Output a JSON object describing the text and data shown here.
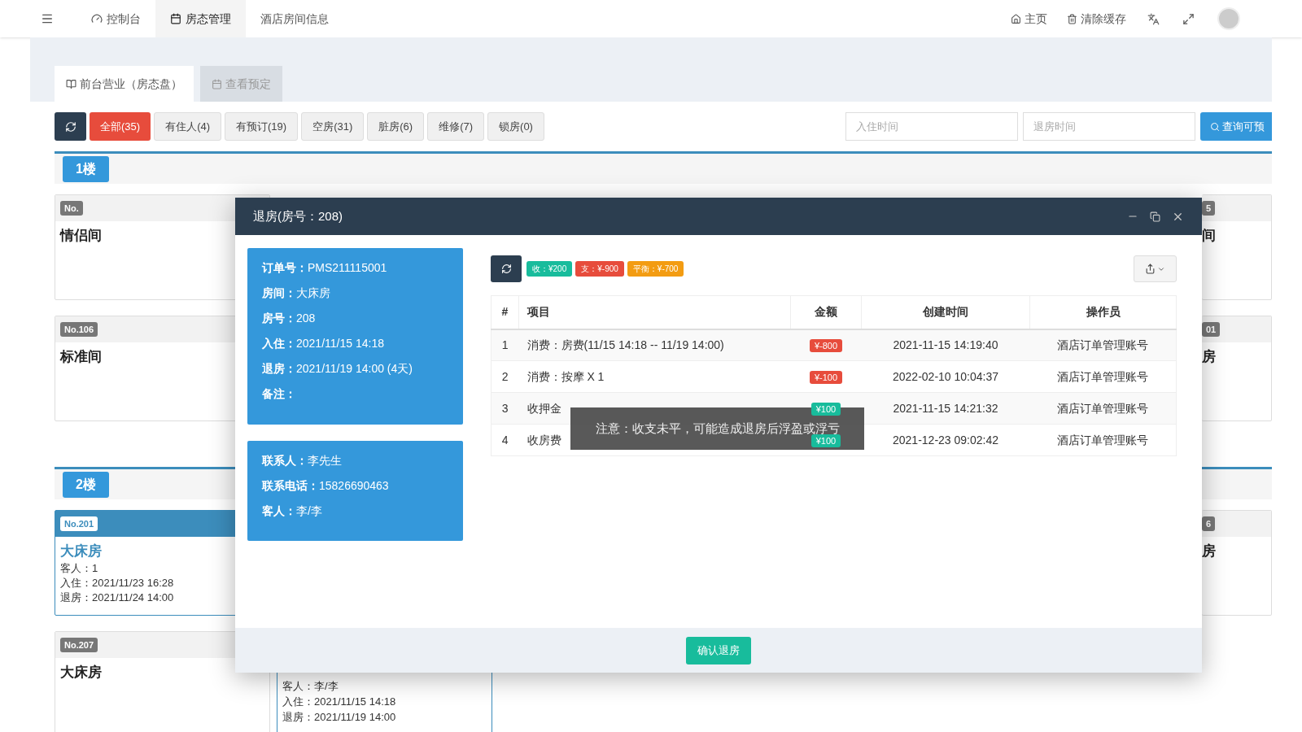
{
  "nav": {
    "items": [
      {
        "label": "控制台",
        "selected": false
      },
      {
        "label": "房态管理",
        "selected": true
      },
      {
        "label": "酒店房间信息",
        "selected": false
      }
    ],
    "right": [
      {
        "label": "主页"
      },
      {
        "label": "清除缓存"
      }
    ]
  },
  "page_tabs": [
    {
      "label": "前台营业（房态盘）",
      "selected": true
    },
    {
      "label": "查看预定",
      "selected": false
    }
  ],
  "filters": [
    {
      "label": "全部(35)",
      "selected": true
    },
    {
      "label": "有住人(4)",
      "selected": false
    },
    {
      "label": "有预订(19)",
      "selected": false
    },
    {
      "label": "空房(31)",
      "selected": false
    },
    {
      "label": "脏房(6)",
      "selected": false
    },
    {
      "label": "维修(7)",
      "selected": false
    },
    {
      "label": "锁房(0)",
      "selected": false
    }
  ],
  "date_fields": [
    {
      "placeholder": "入住时间"
    },
    {
      "placeholder": "退房时间"
    }
  ],
  "search_button": "查询可预",
  "floors": [
    {
      "label": "1楼",
      "rows": [
        {
          "left": {
            "number": "No.",
            "title": "情侣间",
            "occupied": false
          },
          "right": {
            "number": "5",
            "title": "间",
            "occupied": false
          }
        },
        {
          "left": {
            "number": "No.106",
            "title": "标准间",
            "occupied": false
          },
          "right": {
            "number": "01",
            "title": "房",
            "occupied": false
          }
        }
      ]
    },
    {
      "label": "2楼",
      "rows": [
        {
          "left": {
            "number": "No.201",
            "title": "大床房",
            "occupied": true,
            "lines": [
              "客人：1",
              "入住：2021/11/23 16:28",
              "退房：2021/11/24 14:00"
            ]
          },
          "right": {
            "number": "6",
            "title": "房",
            "occupied": false
          }
        },
        {
          "left": {
            "number": "No.207",
            "title": "大床房",
            "occupied": false
          },
          "middle": {
            "occupied": true,
            "lines": [
              "客人：李/李",
              "入住：2021/11/15 14:18",
              "退房：2021/11/19 14:00"
            ]
          }
        }
      ]
    }
  ],
  "modal": {
    "title": "退房(房号：208)",
    "order_panel": [
      "**订单号：**PMS211115001",
      "**房间：**大床房",
      "**房号：**208",
      "**入住：**2021/11/15 14:18",
      "**退房：**2021/11/19 14:00 (4天)",
      "**备注：**"
    ],
    "contact_panel": [
      "**联系人：**李先生",
      "**联系电话：**15826690463",
      "**客人：**李/李"
    ],
    "totals": [
      {
        "text": "收：¥200",
        "kind": "income"
      },
      {
        "text": "支：¥-900",
        "kind": "expense"
      },
      {
        "text": "平衡：¥-700",
        "kind": "balance"
      }
    ],
    "table": {
      "columns": [
        "#",
        "项目",
        "金额",
        "创建时间",
        "操作员"
      ],
      "rows": [
        {
          "index": "1",
          "item": "消费：房费(11/15 14:18 -- 11/19 14:00)",
          "amount": "¥-800",
          "kind": "expense",
          "created": "2021-11-15 14:19:40",
          "operator": "酒店订单管理账号"
        },
        {
          "index": "2",
          "item": "消费：按摩 X 1",
          "amount": "¥-100",
          "kind": "expense",
          "created": "2022-02-10 10:04:37",
          "operator": "酒店订单管理账号"
        },
        {
          "index": "3",
          "item": "收押金",
          "amount": "¥100",
          "kind": "income",
          "created": "2021-11-15 14:21:32",
          "operator": "酒店订单管理账号"
        },
        {
          "index": "4",
          "item": "收房费",
          "amount": "¥100",
          "kind": "income",
          "created": "2021-12-23 09:02:42",
          "operator": "酒店订单管理账号"
        }
      ]
    },
    "toast": "注意：收支未平，可能造成退房后浮盈或浮亏",
    "confirm_button": "确认退房"
  }
}
